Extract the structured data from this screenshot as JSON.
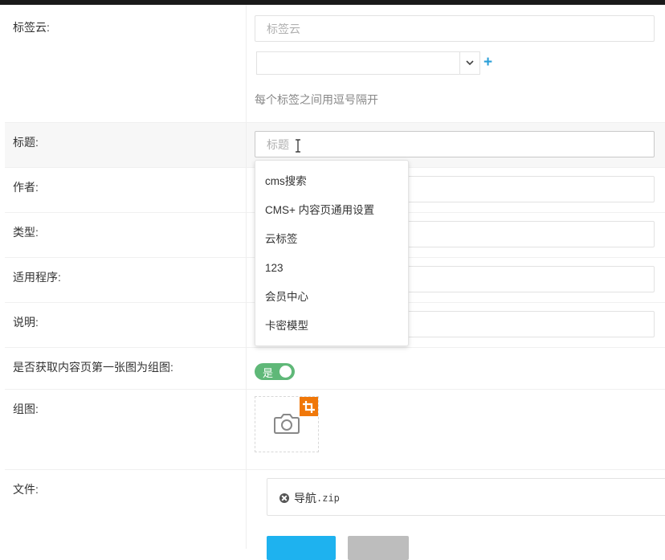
{
  "form": {
    "tags": {
      "label": "标签云:",
      "placeholder": "标签云",
      "hint": "每个标签之间用逗号隔开"
    },
    "title": {
      "label": "标题:",
      "placeholder": "标题"
    },
    "author": {
      "label": "作者:"
    },
    "type": {
      "label": "类型:"
    },
    "program": {
      "label": "适用程序:"
    },
    "description": {
      "label": "说明:"
    },
    "auto_image": {
      "label": "是否获取内容页第一张图为组图:",
      "toggle_text": "是"
    },
    "gallery": {
      "label": "组图:"
    },
    "file": {
      "label": "文件:",
      "name": "导航",
      "ext": ".zip"
    }
  },
  "suggestions": [
    "cms搜索",
    "CMS+ 内容页通用设置",
    "云标签",
    "123",
    "会员中心",
    "卡密模型"
  ],
  "icons": {
    "plus": "+",
    "camera": "camera-icon",
    "crop": "crop-icon",
    "remove": "close-circle-icon"
  },
  "colors": {
    "toggle_on": "#5fb878",
    "accent_blue": "#2a9fd8",
    "crop_badge": "#f0780a",
    "primary_button": "#1eb2ef"
  }
}
